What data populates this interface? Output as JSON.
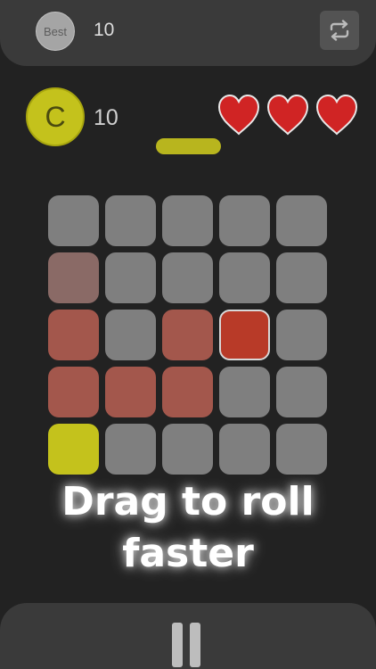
{
  "header": {
    "best_label": "Best",
    "best_value": "10",
    "restart_icon": "repeat-icon"
  },
  "status": {
    "coin_letter": "C",
    "coin_count": "10",
    "lives": 3,
    "progress_fraction": 1.0
  },
  "board": {
    "rows": 5,
    "cols": 5,
    "cells": [
      "empty",
      "empty",
      "empty",
      "empty",
      "empty",
      "trail-faint",
      "empty",
      "empty",
      "empty",
      "empty",
      "trail",
      "empty",
      "trail",
      "current",
      "empty",
      "trail",
      "trail",
      "trail",
      "empty",
      "empty",
      "player",
      "empty",
      "empty",
      "empty",
      "empty"
    ]
  },
  "colors": {
    "empty": "#7f7f7f",
    "trail-faint": "#8a6a66",
    "trail": "#a3574c",
    "current": "#b83a28",
    "player": "#c4c21c"
  },
  "message": "Drag to roll\nfaster",
  "controls": {
    "pause_icon": "pause-icon"
  }
}
